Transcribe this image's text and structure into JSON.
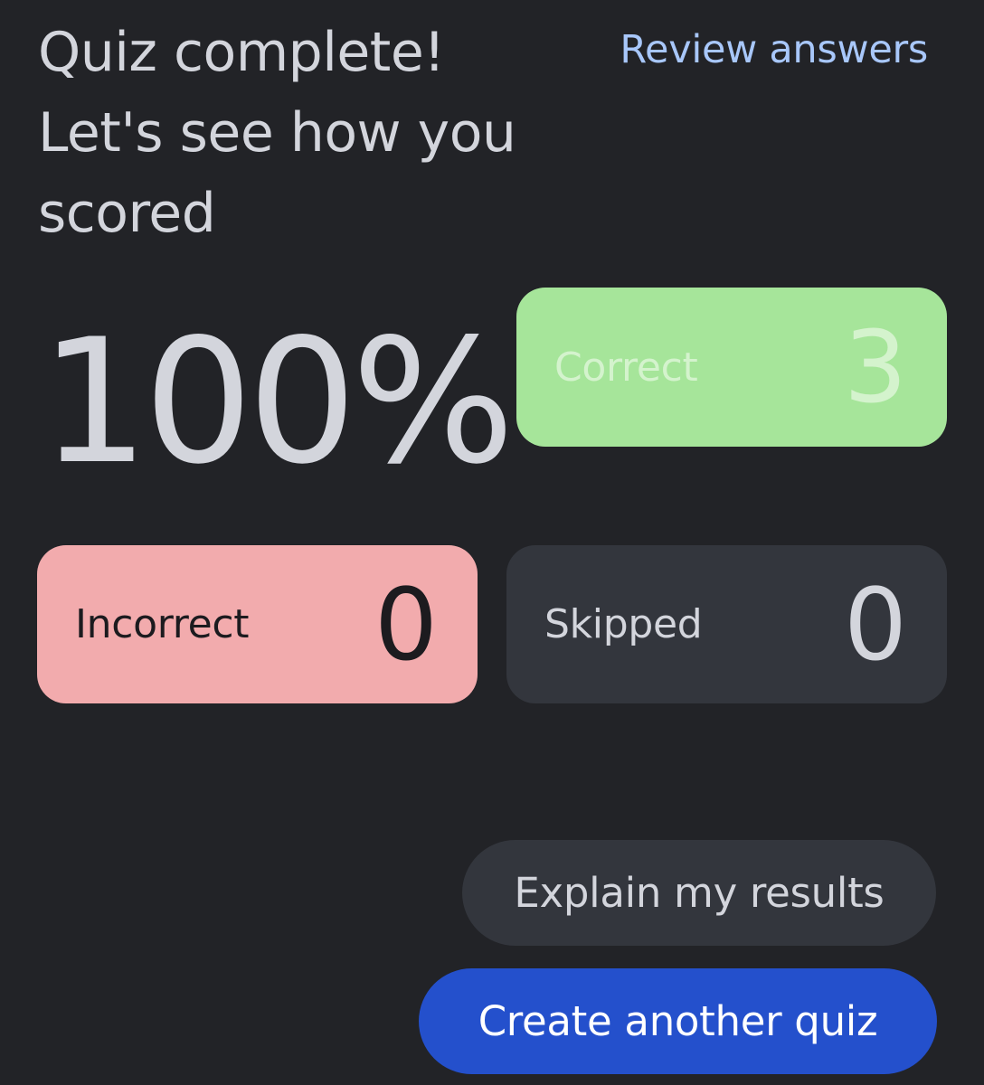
{
  "header": {
    "title": "Quiz complete! Let's see how you scored",
    "review_link": "Review answers"
  },
  "score": {
    "percent": "100%"
  },
  "stats": {
    "correct": {
      "label": "Correct",
      "value": "3",
      "color": "#a6e59a"
    },
    "incorrect": {
      "label": "Incorrect",
      "value": "0",
      "color": "#f2abad"
    },
    "skipped": {
      "label": "Skipped",
      "value": "0",
      "color": "#33363d"
    }
  },
  "actions": {
    "explain_label": "Explain my results",
    "create_label": "Create another quiz"
  },
  "colors": {
    "background": "#222327",
    "link": "#a8c7fa",
    "primary_button": "#2450cc"
  }
}
